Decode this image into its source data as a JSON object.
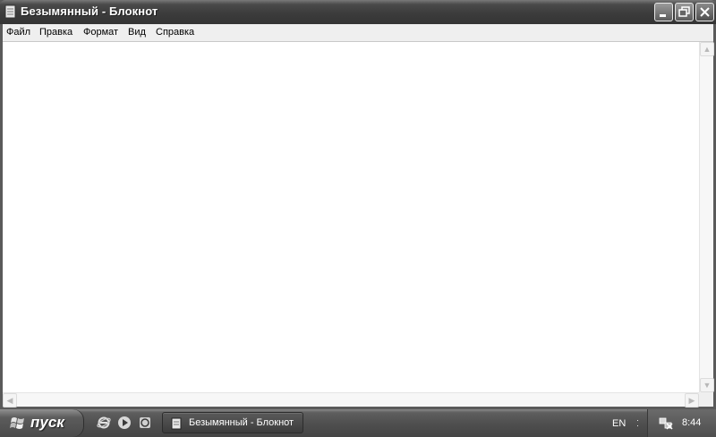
{
  "window": {
    "title": "Безымянный - Блокнот",
    "controls": {
      "minimize": "minimize",
      "maximize": "restore",
      "close": "close"
    }
  },
  "menu": {
    "items": [
      {
        "label": "Файл"
      },
      {
        "label": "Правка"
      },
      {
        "label": "Формат"
      },
      {
        "label": "Вид"
      },
      {
        "label": "Справка"
      }
    ]
  },
  "editor": {
    "content": ""
  },
  "taskbar": {
    "start_label": "пуск",
    "quick_launch": [
      "internet-explorer-icon",
      "media-player-icon",
      "messenger-icon"
    ],
    "task_label": "Безымянный - Блокнот",
    "language": "EN",
    "clock": "8:44"
  },
  "colors": {
    "titlebar": "#3c3c3c",
    "menubar": "#efefef",
    "taskbar": "#4e4e4e",
    "editor_bg": "#ffffff"
  }
}
